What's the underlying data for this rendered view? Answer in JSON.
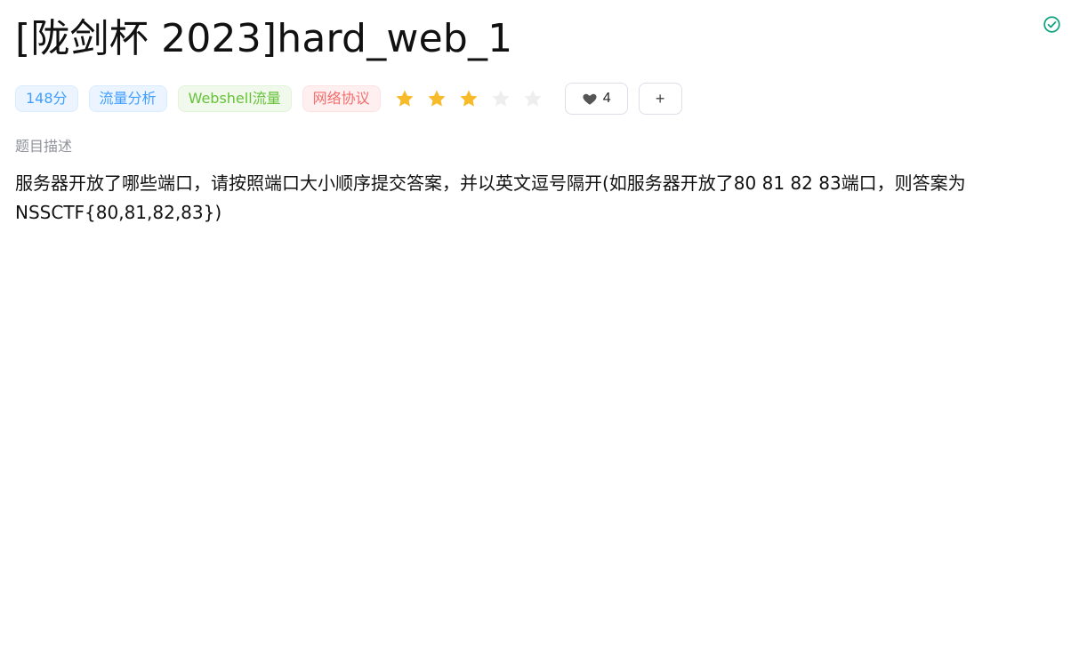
{
  "title": "[陇剑杯 2023]hard_web_1",
  "status": {
    "icon": "check-circle-icon",
    "color": "#10a37f"
  },
  "tags": [
    {
      "label": "148分",
      "style": "score"
    },
    {
      "label": "流量分析",
      "style": "blue"
    },
    {
      "label": "Webshell流量",
      "style": "green"
    },
    {
      "label": "网络协议",
      "style": "red"
    }
  ],
  "rating": {
    "value": 3,
    "max": 5,
    "filled_color": "#f7ba2a",
    "empty_color": "#eeeeee"
  },
  "likes": {
    "icon": "heart-icon",
    "count": "4"
  },
  "add_button": {
    "label": "+"
  },
  "description_label": "题目描述",
  "description": "服务器开放了哪些端口，请按照端口大小顺序提交答案，并以英文逗号隔开(如服务器开放了80 81 82 83端口，则答案为NSSCTF{80,81,82,83})"
}
